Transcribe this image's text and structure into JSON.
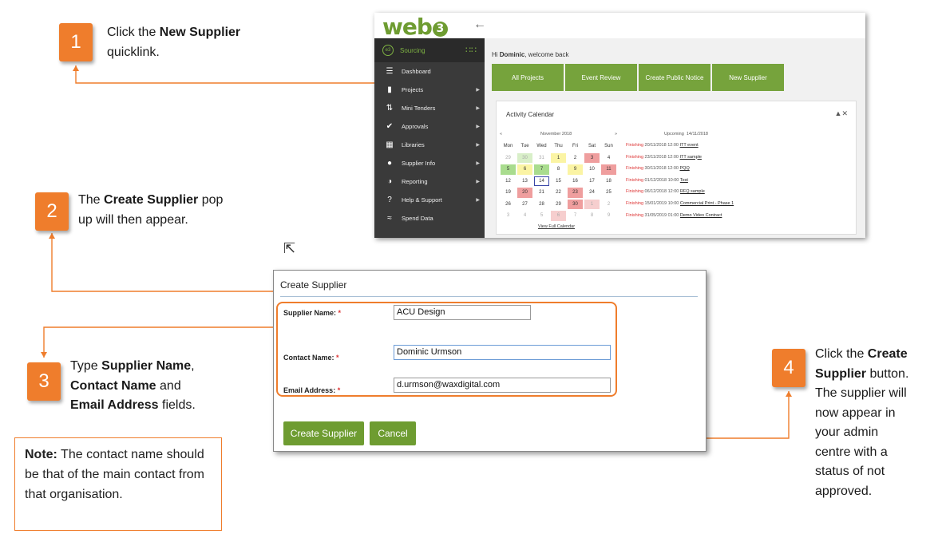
{
  "steps": [
    {
      "num": "1",
      "line1_pre": "Click the ",
      "line1_bold": "New Supplier",
      "line2": "quicklink."
    },
    {
      "num": "2",
      "line1_pre": "The ",
      "line1_bold": "Create Supplier",
      "line1_post": " pop",
      "line2": "up will then appear."
    },
    {
      "num": "3",
      "line1_pre": "Type ",
      "line1_bold": "Supplier Name",
      "line1_post": ",",
      "line2_bold": "Contact Name",
      "line2_post": " and",
      "line3_bold": "Email Address",
      "line3_post": " fields."
    },
    {
      "num": "4",
      "line1_pre": "Click the ",
      "line1_bold": "Create",
      "line2_bold": "Supplier",
      "line2_post": " button.",
      "line3": "The supplier will",
      "line4": "now appear in",
      "line5": "your admin",
      "line6": "centre with a",
      "line7": "status of not",
      "line8": "approved."
    }
  ],
  "note": {
    "label": "Note:",
    "text": " The contact name should be that of the main contact from that organisation."
  },
  "app": {
    "logo": "web",
    "logo_num": "3",
    "sidebar_head": "Sourcing",
    "sidebar": [
      {
        "label": "Dashboard",
        "icon": "list-icon"
      },
      {
        "label": "Projects",
        "icon": "folder-icon"
      },
      {
        "label": "Mini Tenders",
        "icon": "sort-arrows-icon"
      },
      {
        "label": "Approvals",
        "icon": "check-circle-icon"
      },
      {
        "label": "Libraries",
        "icon": "book-icon"
      },
      {
        "label": "Supplier Info",
        "icon": "user-icon"
      },
      {
        "label": "Reporting",
        "icon": "pie-chart-icon"
      },
      {
        "label": "Help & Support",
        "icon": "question-icon"
      },
      {
        "label": "Spend Data",
        "icon": "line-chart-icon"
      }
    ],
    "welcome_pre": "Hi ",
    "welcome_name": "Dominic",
    "welcome_post": ", welcome back",
    "quicklinks": [
      "All Projects",
      "Event Review",
      "Create Public Notice",
      "New Supplier"
    ],
    "calendar": {
      "title": "Activity Calendar",
      "month": "November 2018",
      "prev": "«",
      "next": "»",
      "days": [
        "Mon",
        "Tue",
        "Wed",
        "Thu",
        "Fri",
        "Sat",
        "Sun"
      ],
      "cells": [
        {
          "d": "29",
          "c": "dim"
        },
        {
          "d": "30",
          "c": "dim ltgreen"
        },
        {
          "d": "31",
          "c": "dim"
        },
        {
          "d": "1",
          "c": "yellow"
        },
        {
          "d": "2",
          "c": ""
        },
        {
          "d": "3",
          "c": "red"
        },
        {
          "d": "4",
          "c": ""
        },
        {
          "d": "5",
          "c": "green"
        },
        {
          "d": "6",
          "c": "yellow"
        },
        {
          "d": "7",
          "c": "green"
        },
        {
          "d": "8",
          "c": ""
        },
        {
          "d": "9",
          "c": "yellow"
        },
        {
          "d": "10",
          "c": ""
        },
        {
          "d": "11",
          "c": "red"
        },
        {
          "d": "12",
          "c": ""
        },
        {
          "d": "13",
          "c": ""
        },
        {
          "d": "14",
          "c": "today"
        },
        {
          "d": "15",
          "c": ""
        },
        {
          "d": "16",
          "c": ""
        },
        {
          "d": "17",
          "c": ""
        },
        {
          "d": "18",
          "c": ""
        },
        {
          "d": "19",
          "c": ""
        },
        {
          "d": "20",
          "c": "red"
        },
        {
          "d": "21",
          "c": ""
        },
        {
          "d": "22",
          "c": ""
        },
        {
          "d": "23",
          "c": "red"
        },
        {
          "d": "24",
          "c": ""
        },
        {
          "d": "25",
          "c": ""
        },
        {
          "d": "26",
          "c": ""
        },
        {
          "d": "27",
          "c": ""
        },
        {
          "d": "28",
          "c": ""
        },
        {
          "d": "29",
          "c": ""
        },
        {
          "d": "30",
          "c": "red"
        },
        {
          "d": "1",
          "c": "dim ltred"
        },
        {
          "d": "2",
          "c": "dim"
        },
        {
          "d": "3",
          "c": "dim"
        },
        {
          "d": "4",
          "c": "dim"
        },
        {
          "d": "5",
          "c": "dim"
        },
        {
          "d": "6",
          "c": "dim ltred"
        },
        {
          "d": "7",
          "c": "dim"
        },
        {
          "d": "8",
          "c": "dim"
        },
        {
          "d": "9",
          "c": "dim"
        }
      ],
      "view_full": "View Full Calendar",
      "upcoming_label": "Upcoming",
      "upcoming_date": "14/11/2018",
      "upcoming": [
        {
          "status": "Finishing",
          "when": "20/11/2018 12:00",
          "name": "ITT event"
        },
        {
          "status": "Finishing",
          "when": "23/11/2018 12:00",
          "name": "ITT sample"
        },
        {
          "status": "Finishing",
          "when": "30/11/2018 12:00",
          "name": "PQQ"
        },
        {
          "status": "Finishing",
          "when": "01/12/2018 10:00",
          "name": "Test"
        },
        {
          "status": "Finishing",
          "when": "06/12/2018 12:00",
          "name": "RFQ sample"
        },
        {
          "status": "Finishing",
          "when": "15/01/2019 10:00",
          "name": "Commercial Print - Phase 1"
        },
        {
          "status": "Finishing",
          "when": "31/05/2019 01:00",
          "name": "Demo Video Contract"
        }
      ]
    }
  },
  "dialog": {
    "title": "Create Supplier",
    "fields": [
      {
        "label": "Supplier Name:",
        "req": "*",
        "value": "ACU Design"
      },
      {
        "label": "Contact Name:",
        "req": "*",
        "value": "Dominic Urmson"
      },
      {
        "label": "Email Address:",
        "req": "*",
        "value": "d.urmson@waxdigital.com"
      }
    ],
    "create_btn": "Create Supplier",
    "cancel_btn": "Cancel"
  },
  "colors": {
    "accent": "#ef7d2c",
    "brand_green": "#76a33c",
    "sidebar": "#3a3a3a"
  }
}
